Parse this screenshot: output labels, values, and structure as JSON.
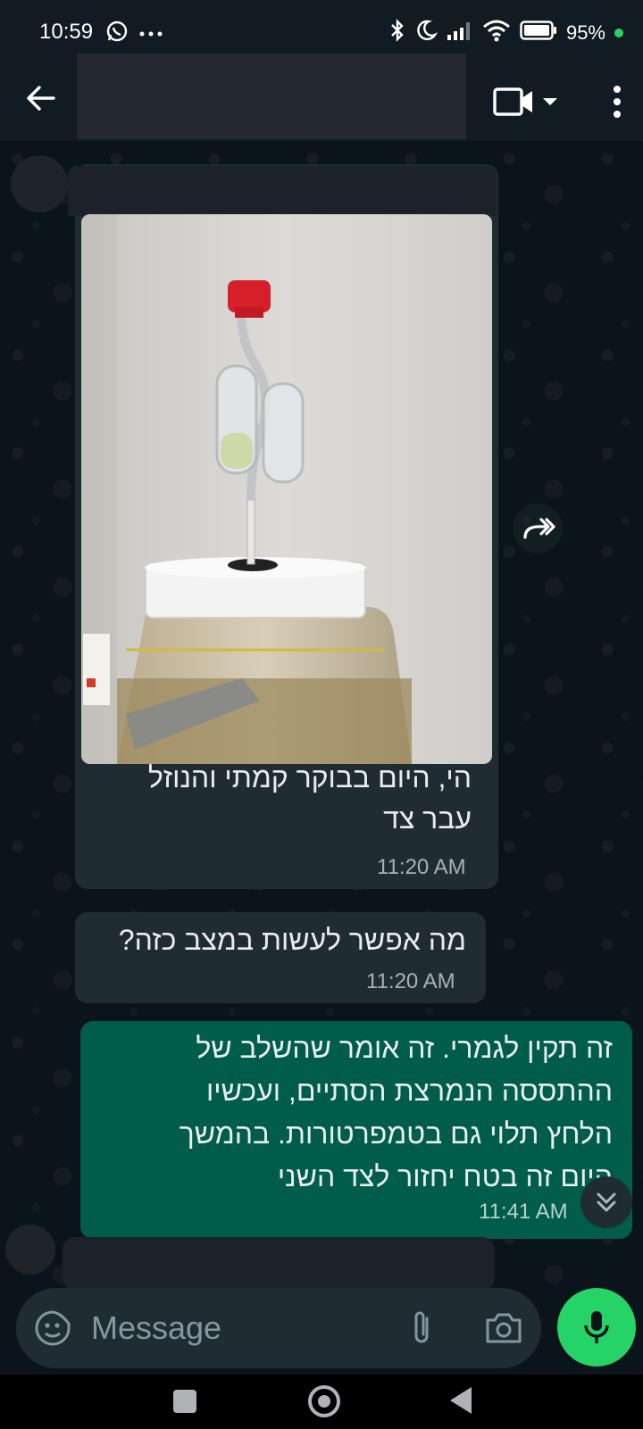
{
  "status_bar": {
    "time": "10:59",
    "battery": "95%",
    "icons": [
      "whatsapp-icon",
      "more-dots-icon",
      "bluetooth-icon",
      "moon-icon",
      "signal-icon",
      "wifi-icon",
      "battery-icon"
    ]
  },
  "header": {
    "icons": [
      "back-arrow-icon",
      "video-call-icon",
      "chevron-down-icon",
      "kebab-menu-icon"
    ]
  },
  "messages": [
    {
      "direction": "incoming",
      "has_image": true,
      "text": "הי, היום בבוקר קמתי והנוזל עבר צד",
      "line1": "הי, היום בבוקר קמתי והנוזל",
      "line2": "עבר צד",
      "time": "11:20 AM"
    },
    {
      "direction": "incoming",
      "text": "מה אפשר לעשות במצב כזה?",
      "time": "11:20 AM"
    },
    {
      "direction": "outgoing",
      "text": "זה תקין לגמרי. זה אומר שהשלב של ההתססה הנמרצת הסתיים, ועכשיו הלחץ תלוי גם בטמפרטורות. בהמשך היום זה בטח יחזור לצד השני",
      "lines": [
        "זה תקין לגמרי. זה אומר שהשלב של",
        "ההתססה הנמרצת הסתיים, ועכשיו",
        "הלחץ תלוי גם בטמפרטורות. בהמשך",
        "היום זה בטח יחזור לצד השני"
      ],
      "time": "11:41 AM"
    }
  ],
  "composer": {
    "placeholder": "Message",
    "icons": [
      "sticker-emoji-icon",
      "paperclip-icon",
      "camera-icon",
      "mic-icon"
    ]
  },
  "colors": {
    "background": "#0b141a",
    "incoming_bubble": "#202c33",
    "outgoing_bubble": "#005c4b",
    "accent": "#25d366"
  }
}
